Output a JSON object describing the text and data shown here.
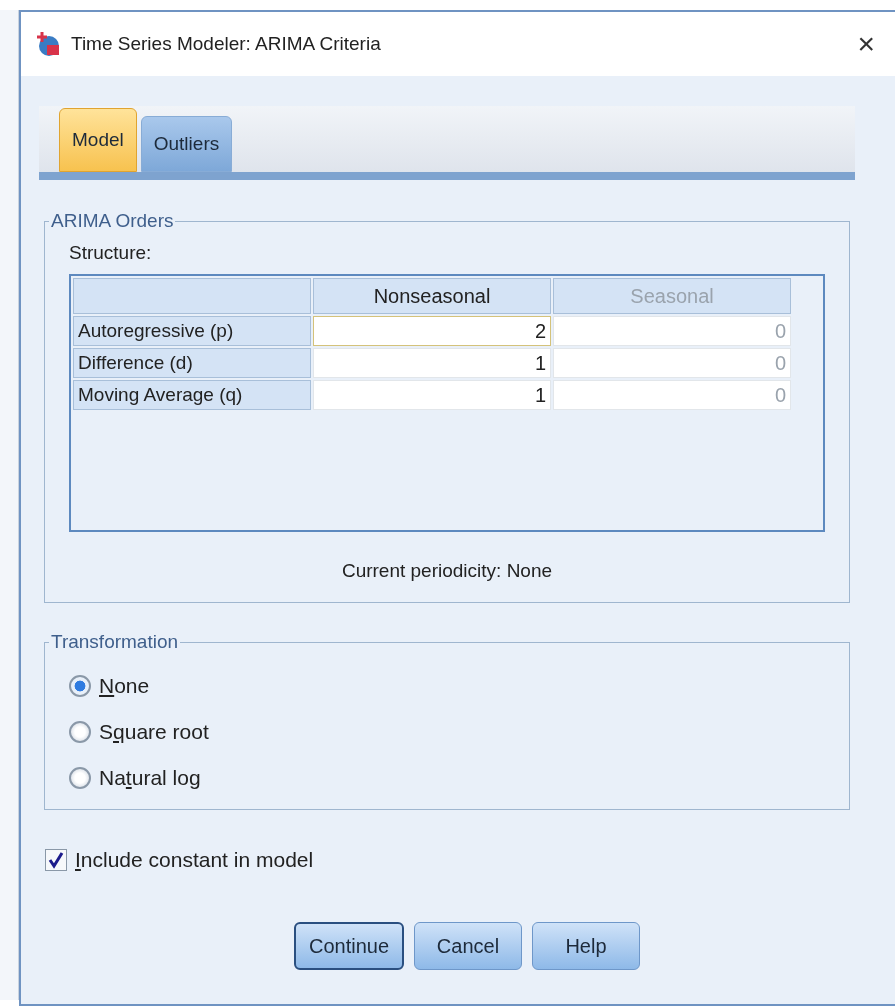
{
  "window": {
    "title": "Time Series Modeler: ARIMA Criteria",
    "close": "×"
  },
  "tabs": [
    {
      "label": "Model",
      "selected": true
    },
    {
      "label": "Outliers",
      "selected": false
    }
  ],
  "arima_orders": {
    "title": "ARIMA Orders",
    "structure_label": "Structure:",
    "columns": [
      {
        "label": "Nonseasonal",
        "disabled": false
      },
      {
        "label": "Seasonal",
        "disabled": true
      }
    ],
    "rows": [
      {
        "label": "Autoregressive (p)",
        "values": [
          "2",
          "0"
        ],
        "focused": true
      },
      {
        "label": "Difference (d)",
        "values": [
          "1",
          "0"
        ],
        "focused": false
      },
      {
        "label": "Moving Average (q)",
        "values": [
          "1",
          "0"
        ],
        "focused": false
      }
    ],
    "periodicity": "Current periodicity: None"
  },
  "transformation": {
    "title": "Transformation",
    "options": [
      {
        "label": {
          "key": "N",
          "after": "one"
        },
        "selected": true
      },
      {
        "label": {
          "before": "S",
          "key": "q",
          "after": "uare root"
        },
        "selected": false
      },
      {
        "label": {
          "before": "Na",
          "key": "t",
          "after": "ural log"
        },
        "selected": false
      }
    ]
  },
  "include_constant": {
    "label": {
      "key": "I",
      "after": "nclude constant in model"
    },
    "checked": true
  },
  "buttons": [
    {
      "label": "Continue",
      "default": true
    },
    {
      "label": "Cancel",
      "default": false
    },
    {
      "label": "Help",
      "default": false
    }
  ]
}
